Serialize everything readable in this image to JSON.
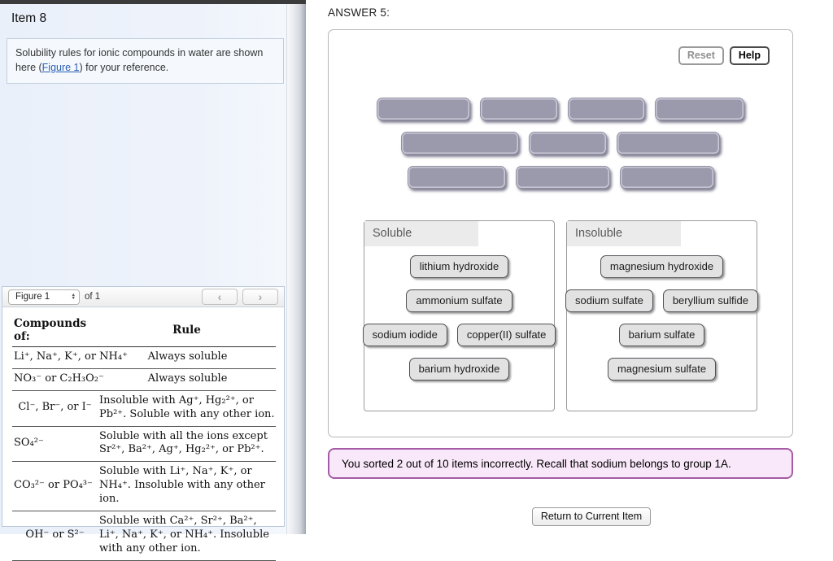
{
  "left_panel": {
    "item_title": "Item 8",
    "intro": {
      "text_before_link": "Solubility rules for ionic compounds in water are shown here (",
      "link_label": "Figure 1",
      "text_after_link": ") for your reference."
    },
    "figure_nav": {
      "selected_figure": "Figure 1",
      "count_label": "of 1",
      "stepper_up_icon": "▲",
      "stepper_down_icon": "▼",
      "prev_icon": "‹",
      "next_icon": "›"
    },
    "solubility_table": {
      "headers": [
        "Compounds of:",
        "Rule"
      ],
      "rows": [
        {
          "compound": "Li⁺, Na⁺, K⁺, or NH₄⁺",
          "rule": "Always soluble"
        },
        {
          "compound": "NO₃⁻ or C₂H₃O₂⁻",
          "rule": "Always soluble"
        },
        {
          "compound": "Cl⁻, Br⁻, or I⁻",
          "rule": "Insoluble with Ag⁺, Hg₂²⁺, or Pb²⁺. Soluble with any other ion."
        },
        {
          "compound": "SO₄²⁻",
          "rule": "Soluble with all the ions except Sr²⁺, Ba²⁺, Ag⁺, Hg₂²⁺, or Pb²⁺."
        },
        {
          "compound": "CO₃²⁻ or PO₄³⁻",
          "rule": "Soluble with Li⁺, Na⁺, K⁺, or NH₄⁺. Insoluble with any other ion."
        },
        {
          "compound": "OH⁻ or S²⁻",
          "rule": "Soluble with Ca²⁺, Sr²⁺, Ba²⁺, Li⁺, Na⁺, K⁺, or NH₄⁺. Insoluble with any other ion."
        }
      ]
    }
  },
  "answer_panel": {
    "heading": "ANSWER 5:",
    "toolbar": {
      "reset_label": "Reset",
      "help_label": "Help"
    },
    "unsorted_slots": {
      "rows": [
        4,
        3,
        3
      ]
    },
    "bins": [
      {
        "title": "Soluble",
        "rows": [
          [
            "lithium hydroxide"
          ],
          [
            "ammonium sulfate"
          ],
          [
            "sodium iodide",
            "copper(II) sulfate"
          ],
          [
            "barium hydroxide"
          ]
        ]
      },
      {
        "title": "Insoluble",
        "rows": [
          [
            "magnesium hydroxide"
          ],
          [
            "sodium sulfate",
            "beryllium sulfide"
          ],
          [
            "barium sulfate"
          ],
          [
            "magnesium sulfate"
          ]
        ]
      }
    ],
    "feedback_message": "You sorted 2 out of 10 items incorrectly. Recall that sodium belongs to group 1A.",
    "return_button_label": "Return to Current Item"
  },
  "colors": {
    "slot_fill": "#9b9aac",
    "feedback_background": "#f9e8f9",
    "feedback_border": "#a55ba5",
    "link": "#2b5fb4",
    "left_pane_background": "#edf2fb",
    "top_bar": "#3b3b3b"
  }
}
